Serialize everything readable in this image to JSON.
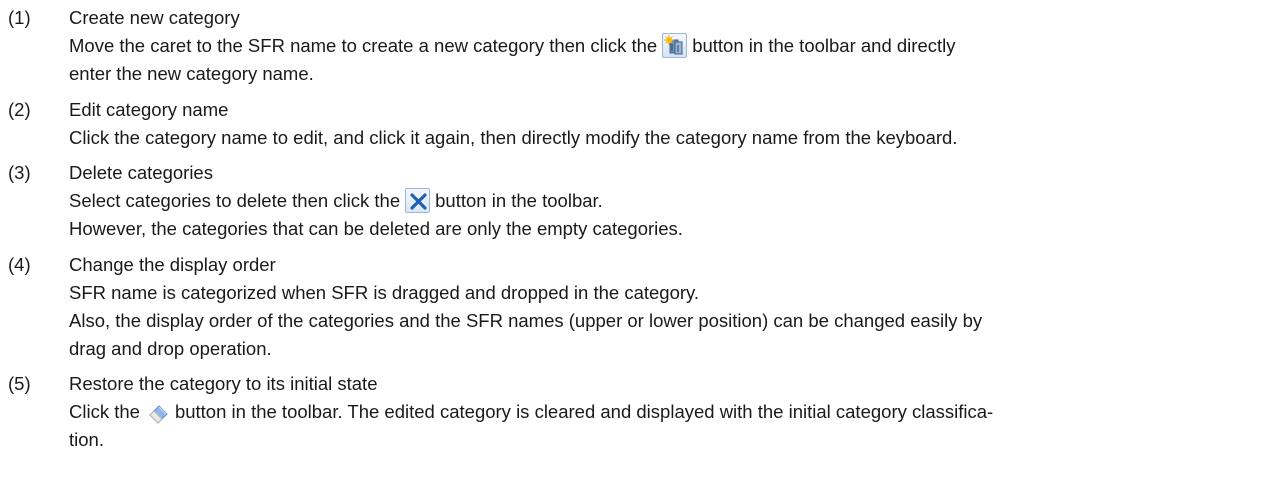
{
  "items": [
    {
      "number": "(1)",
      "title": "Create new category",
      "line1_before": "Move the caret to the SFR name to create a new category then click the",
      "line1_after": "button in the toolbar and directly",
      "line2": "enter the new category name.",
      "icon": "new-category-icon"
    },
    {
      "number": "(2)",
      "title": "Edit category name",
      "line1": "Click the category name to edit, and click it again, then directly modify the category name from the keyboard."
    },
    {
      "number": "(3)",
      "title": "Delete categories",
      "line1_before": "Select categories to delete then click the",
      "line1_after": "button in the toolbar.",
      "line2": "However, the categories that can be deleted are only the empty categories.",
      "icon": "delete-x-icon"
    },
    {
      "number": "(4)",
      "title": "Change the display order",
      "line1": "SFR name is categorized when SFR is dragged and dropped in the category.",
      "line2": "Also, the display order of the categories and the SFR names (upper or lower position) can be changed easily by",
      "line3": "drag and drop operation."
    },
    {
      "number": "(5)",
      "title": "Restore the category to its initial state",
      "line1_before": "Click the",
      "line1_after": "button in the toolbar. The edited category is cleared and displayed with the initial category classifica-",
      "line2": "tion.",
      "icon": "eraser-icon"
    }
  ]
}
